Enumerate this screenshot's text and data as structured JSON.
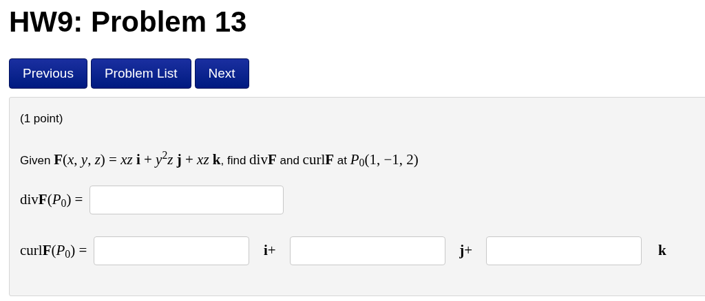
{
  "title": "HW9: Problem 13",
  "nav_buttons": [
    "Previous",
    "Problem List",
    "Next"
  ],
  "problem": {
    "points": "(1 point)",
    "prompt": [
      {
        "kind": "text",
        "text": "Given "
      },
      {
        "kind": "math",
        "text": "**F**(*x*, *y*, *z*) = *xz* **i** + *y*$^{2}$*z* **j** + *xz* **k**"
      },
      {
        "kind": "text",
        "text": ", find "
      },
      {
        "kind": "math",
        "text": "div**F**"
      },
      {
        "kind": "text",
        "text": " and "
      },
      {
        "kind": "math",
        "text": "curl**F**"
      },
      {
        "kind": "text",
        "text": " at "
      },
      {
        "kind": "math",
        "text": "*P*$_{0}$(1, −1, 2)"
      }
    ],
    "answers": [
      {
        "label": "div**F**(*P*$_{0}$) =",
        "parts": [
          {
            "kind": "field"
          }
        ]
      },
      {
        "label": "curl**F**(*P*$_{0}$) =",
        "parts": [
          {
            "kind": "field"
          },
          {
            "kind": "unit",
            "text": "**i**+"
          },
          {
            "kind": "field"
          },
          {
            "kind": "unit",
            "text": "**j**+"
          },
          {
            "kind": "field"
          },
          {
            "kind": "unit",
            "text": "**k**"
          }
        ]
      }
    ]
  }
}
